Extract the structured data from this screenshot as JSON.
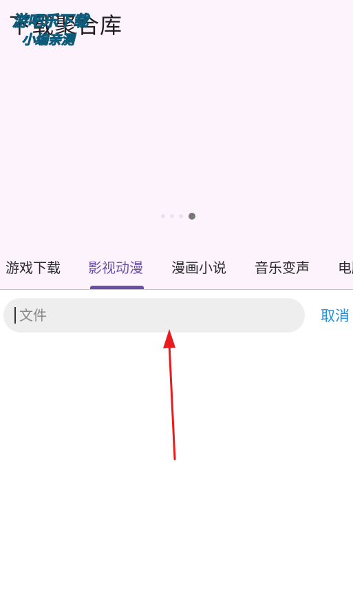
{
  "app": {
    "title": "下载聚合库",
    "watermark_line1": "游吧乐下载",
    "watermark_line2": "小编亲测"
  },
  "carousel": {
    "page_count": 4,
    "active_index": 3
  },
  "tabs": [
    {
      "label": "游戏下载",
      "active": false
    },
    {
      "label": "影视动漫",
      "active": true
    },
    {
      "label": "漫画小说",
      "active": false
    },
    {
      "label": "音乐变声",
      "active": false
    },
    {
      "label": "电脑",
      "active": false
    }
  ],
  "search": {
    "placeholder": "文件",
    "value": "",
    "cancel_label": "取消"
  },
  "colors": {
    "accent": "#6a4fa5",
    "header_bg": "#fcf3fc",
    "cancel_blue": "#1e8fe0",
    "annotation_arrow": "#e81c1c"
  }
}
